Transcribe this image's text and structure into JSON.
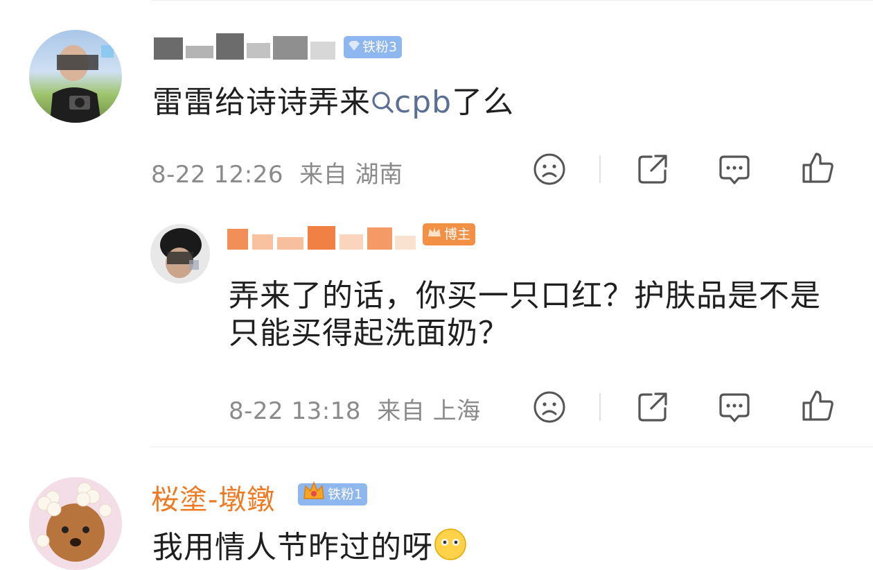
{
  "comments": [
    {
      "badge": "铁粉3",
      "text_prefix": "雷雷给诗诗弄来",
      "keyword": "cpb",
      "text_suffix": "了么",
      "date": "8-22 12:26",
      "source": "来自 湖南"
    },
    {
      "badge": "博主",
      "text": "弄来了的话，你买一只口红？护肤品是不是只能买得起洗面奶？",
      "date": "8-22 13:18",
      "source": "来自 上海"
    },
    {
      "username": "桜塗-墩鐓",
      "badge": "铁粉1",
      "text": "我用情人节昨过的呀"
    }
  ],
  "icons": [
    "dislike-face-icon",
    "share-icon",
    "comment-icon",
    "like-icon"
  ],
  "colors": {
    "username": "#ee7a24",
    "keyword": "#5a6f93",
    "badge_blue": "#8fb7ef",
    "meta": "#8a8a8a"
  }
}
